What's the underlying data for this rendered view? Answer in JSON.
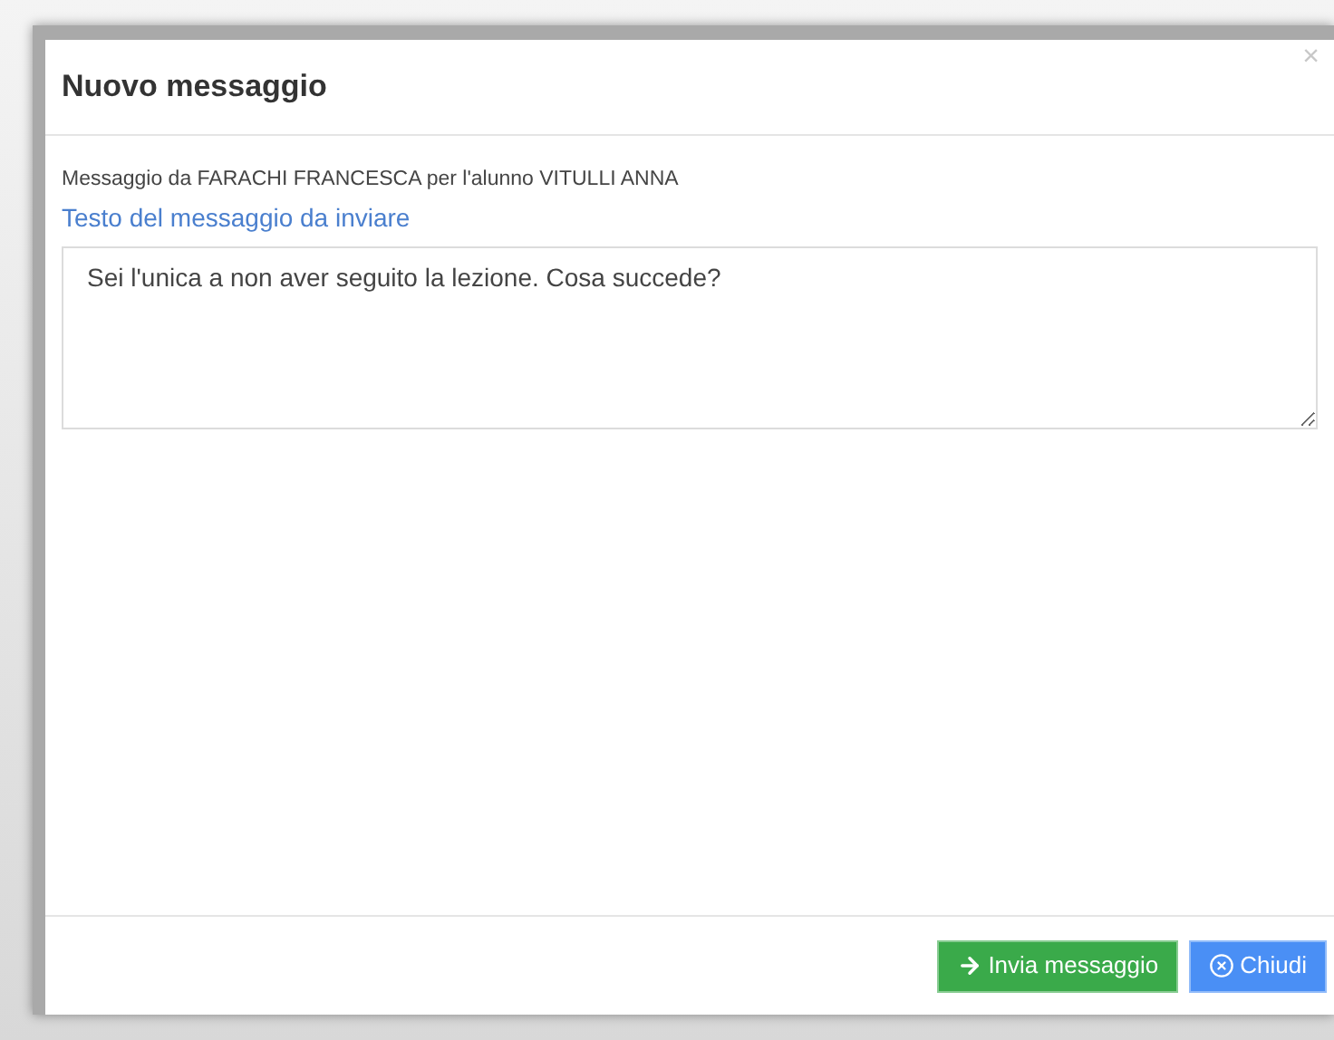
{
  "dialog": {
    "title": "Nuovo messaggio",
    "close": "×"
  },
  "info": "Messaggio da FARACHI FRANCESCA per l'alunno VITULLI ANNA",
  "label": "Testo del messaggio da inviare",
  "message": {
    "value": "Sei l'unica a non aver seguito la lezione. Cosa succede?"
  },
  "buttons": [
    {
      "kind": "send",
      "label": "Invia messaggio"
    },
    {
      "kind": "close",
      "label": "Chiudi"
    }
  ]
}
